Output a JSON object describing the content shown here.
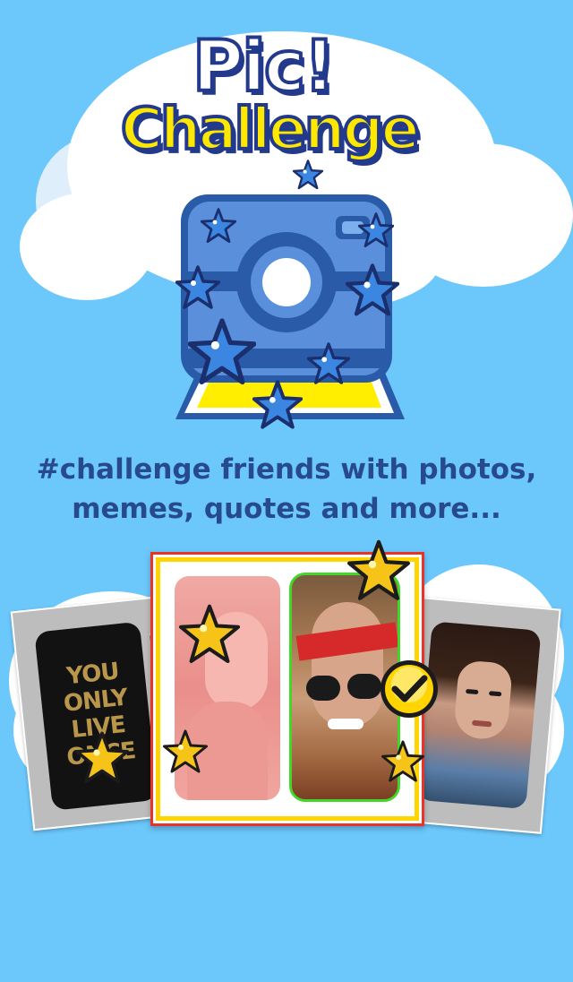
{
  "logo": {
    "line1": "Pic!",
    "line2": "Challenge"
  },
  "tagline": {
    "line1": "#challenge friends with photos,",
    "line2": "memes, quotes and more..."
  },
  "cards": {
    "left_card_text": [
      "YOU",
      "ONLY",
      "LIVE",
      "ONCE"
    ]
  },
  "icons": [
    "camera-icon",
    "star-icon",
    "checkmark-badge-icon"
  ],
  "colors": {
    "background": "#6cc7fb",
    "accent_blue": "#274a8f",
    "accent_yellow": "#ffe800",
    "card_border_red": "#e8332a",
    "card_border_yellow": "#ffd400",
    "selected_green": "#44d629"
  }
}
